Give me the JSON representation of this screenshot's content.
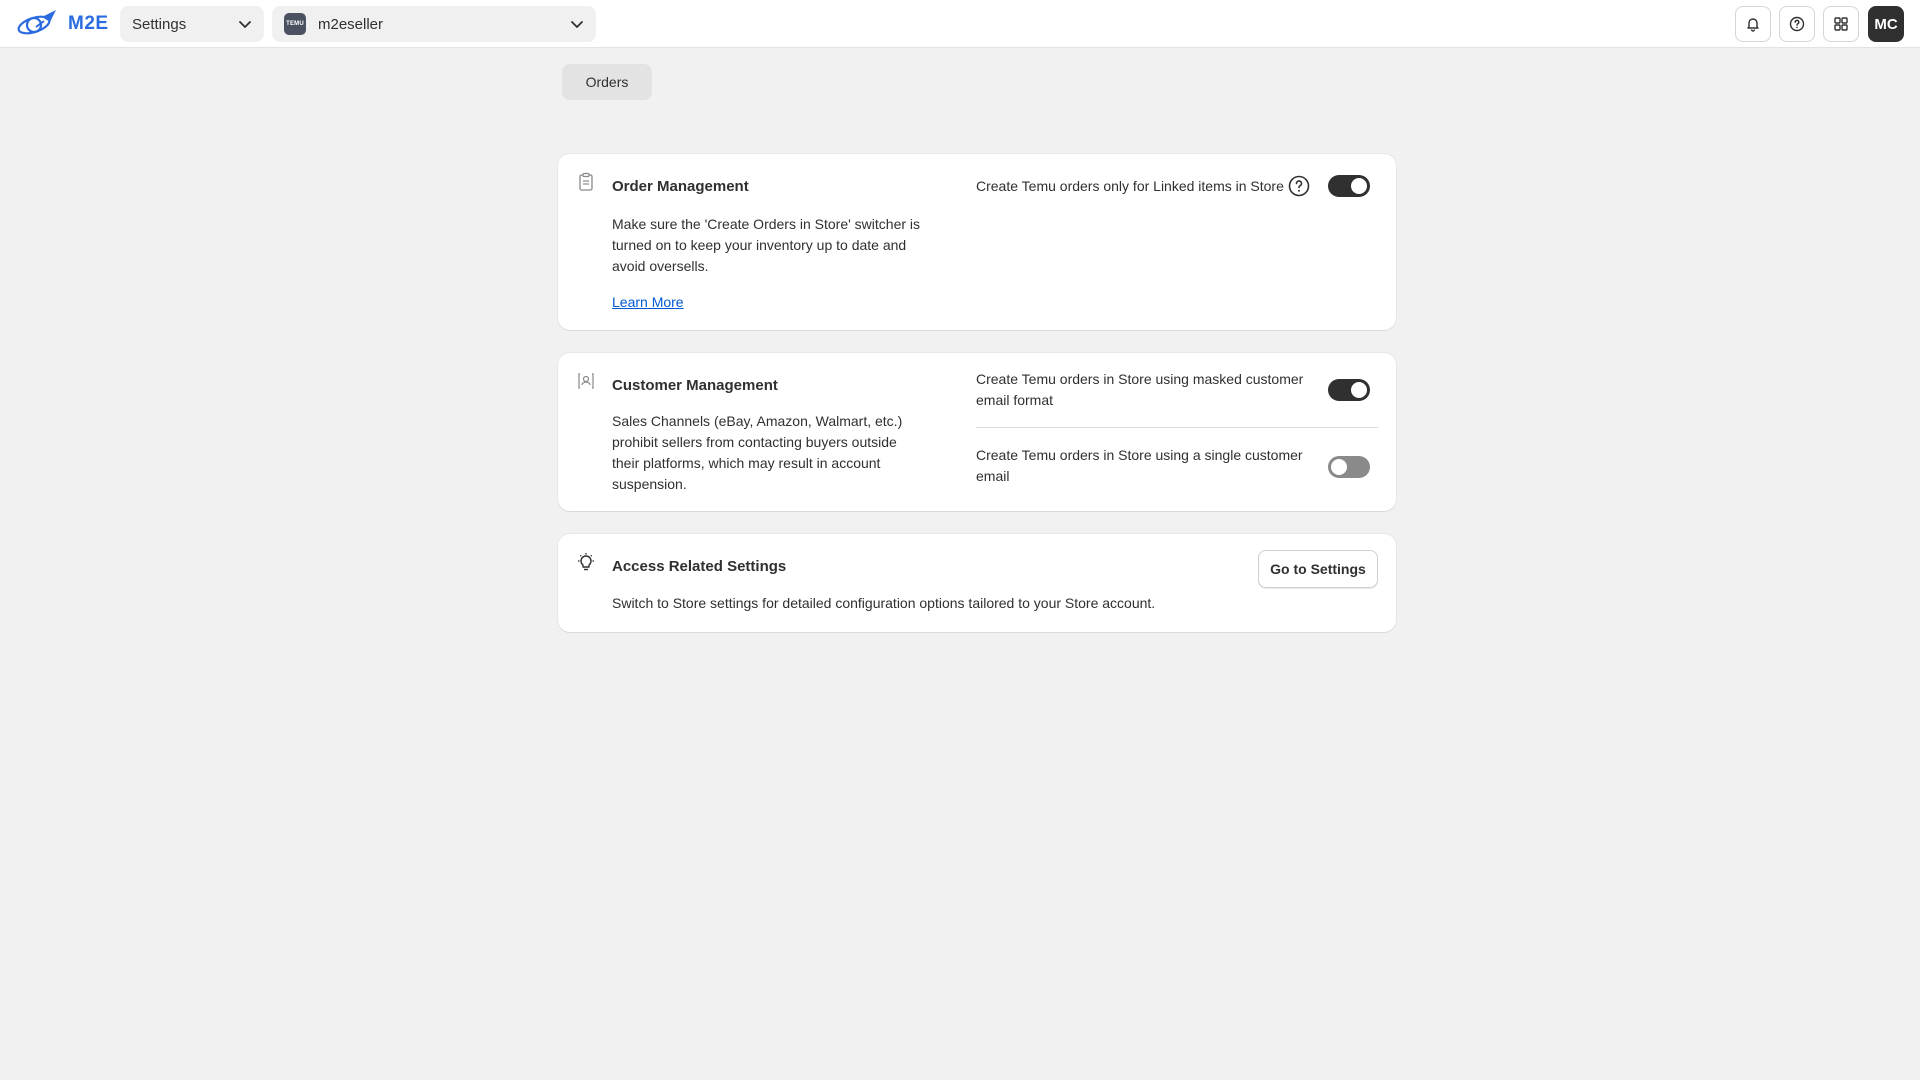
{
  "header": {
    "logo_text": "M2E",
    "section_select": "Settings",
    "account_select": "m2eseller",
    "account_badge": "TEMU",
    "avatar_initials": "MC",
    "icons": [
      "bell-icon",
      "help-circle-icon",
      "apps-grid-icon"
    ]
  },
  "tabs": {
    "orders": "Orders"
  },
  "order_management": {
    "title": "Order Management",
    "description": "Make sure the 'Create Orders in Store' switcher is turned on to keep your inventory up to date and avoid oversells.",
    "learn_more": "Learn More",
    "setting_label": "Create Temu orders only for Linked items in Store",
    "setting_enabled": true
  },
  "customer_management": {
    "title": "Customer Management",
    "description": "Sales Channels (eBay, Amazon, Walmart, etc.) prohibit sellers from contacting buyers outside their platforms, which may result in account suspension.",
    "setting1_label": "Create Temu orders in Store using masked customer email format",
    "setting1_enabled": true,
    "setting2_label": "Create Temu orders in Store using a single customer email",
    "setting2_enabled": false
  },
  "access_settings": {
    "title": "Access Related Settings",
    "description": "Switch to Store settings for detailed configuration options tailored to your Store account.",
    "button": "Go to Settings"
  },
  "colors": {
    "accent": "#2b6be0",
    "link": "#005bd3",
    "toggle_on": "#303030",
    "toggle_off": "#8a8a8a",
    "background": "#f1f1f1"
  }
}
